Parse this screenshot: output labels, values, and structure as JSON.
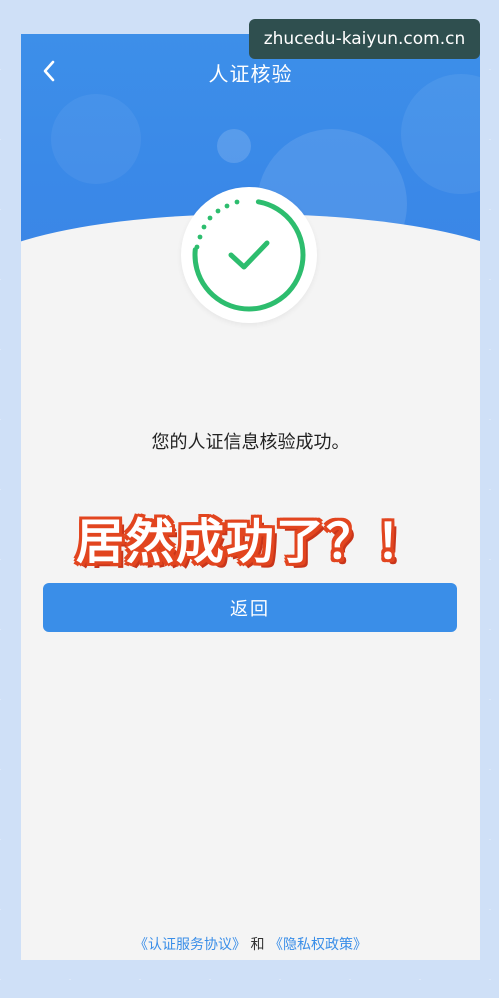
{
  "watermark": {
    "text": "zhucedu-kaiyun.com.cn"
  },
  "header": {
    "title": "人证核验"
  },
  "status": {
    "message": "您的人证信息核验成功。"
  },
  "overlay": {
    "caption": "居然成功了？！",
    "color": "#e2451f"
  },
  "actions": {
    "return_label": "返回"
  },
  "footer": {
    "agreement_link": "《认证服务协议》",
    "conjunction": "和",
    "privacy_link": "《隐私权政策》"
  },
  "colors": {
    "brand_blue": "#3a8ee8",
    "success_green": "#2dbd6e",
    "background": "#f4f4f4"
  },
  "icons": {
    "back": "chevron-left-icon",
    "success": "checkmark-circle-icon"
  }
}
